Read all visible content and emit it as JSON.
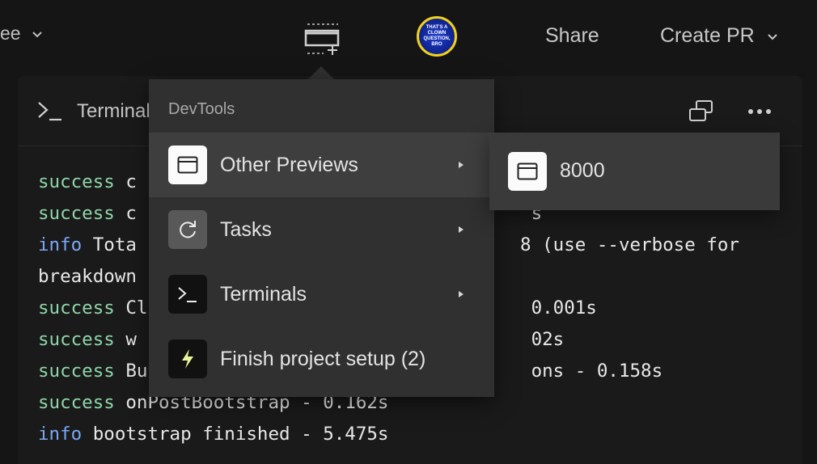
{
  "topbar": {
    "left_fragment": "ee",
    "share_label": "Share",
    "create_pr_label": "Create PR",
    "avatar_text": "THAT'S A CLOWN QUESTION, BRO"
  },
  "panel": {
    "title": "Terminal"
  },
  "terminal_lines": [
    [
      {
        "t": "success",
        "c": "kw-success"
      },
      {
        "t": " c"
      }
    ],
    [
      {
        "t": "success",
        "c": "kw-success"
      },
      {
        "t": " c                                    s"
      }
    ],
    [
      {
        "t": "info",
        "c": "kw-info"
      },
      {
        "t": " Tota                                   8 (use --verbose for"
      }
    ],
    [
      {
        "t": "breakdown"
      }
    ],
    [
      {
        "t": "success",
        "c": "kw-success"
      },
      {
        "t": " Cl                                   0.001s"
      }
    ],
    [
      {
        "t": "success",
        "c": "kw-success"
      },
      {
        "t": " w                                    02s"
      }
    ],
    [
      {
        "t": "success",
        "c": "kw-success"
      },
      {
        "t": " Bu                                   ons - 0.158s"
      }
    ],
    [
      {
        "t": "success",
        "c": "kw-success"
      },
      {
        "t": " onPostBootstrap - 0.162s"
      }
    ],
    [
      {
        "t": "info",
        "c": "kw-info"
      },
      {
        "t": " bootstrap finished - 5.475s"
      }
    ]
  ],
  "menu": {
    "heading": "DevTools",
    "items": [
      {
        "label": "Other Previews",
        "icon": "window-icon",
        "has_submenu": true,
        "active": true
      },
      {
        "label": "Tasks",
        "icon": "refresh-icon",
        "has_submenu": true,
        "active": false
      },
      {
        "label": "Terminals",
        "icon": "terminal-icon",
        "has_submenu": true,
        "active": false
      },
      {
        "label": "Finish project setup (2)",
        "icon": "lightning-icon",
        "has_submenu": false,
        "active": false
      }
    ]
  },
  "submenu": {
    "items": [
      {
        "label": "8000",
        "icon": "window-icon"
      }
    ]
  },
  "colors": {
    "background": "#151515",
    "menu_bg": "#303030",
    "success": "#8fd6a9",
    "info": "#7aa8f5",
    "avatar_border": "#f2d21b",
    "lightning": "#e9f59a"
  }
}
